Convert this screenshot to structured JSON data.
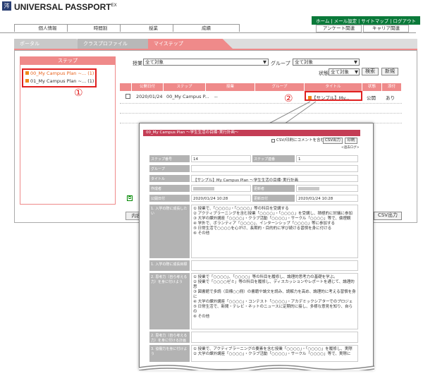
{
  "app": {
    "logo_glyph": "涔",
    "title": "UNIVERSAL PASSPORT",
    "title_suffix": "EX"
  },
  "top_links": [
    "ホーム",
    "メール設定",
    "サイトマップ",
    "ログアウト"
  ],
  "sub_links": [
    "アンケート関連",
    "キャリア関連"
  ],
  "main_tabs": [
    "個人情報",
    "時間割",
    "授業",
    "成績"
  ],
  "tabs2": {
    "portal": "ポータル",
    "class_profile": "クラスプロファイル",
    "mystep": "マイステップ"
  },
  "step_panel": {
    "header": "ステップ",
    "items": [
      {
        "label": "00_My Campus Plan ~...",
        "count": "(1)"
      },
      {
        "label": "01_My Campus Plan ~...",
        "count": "(1)"
      }
    ]
  },
  "annotations": {
    "one": "①",
    "two": "②"
  },
  "filters": {
    "jugyo_label": "授業",
    "jugyo_value": "全て対象",
    "group_label": "グループ",
    "group_value": "全て対象",
    "state_label": "状態",
    "state_value": "全て対象",
    "search_btn": "検索",
    "new_btn": "新規"
  },
  "table": {
    "headers": [
      "公開日付",
      "ステップ",
      "授業",
      "グループ",
      "タイトル",
      "状態",
      "添付"
    ],
    "rows": [
      {
        "date": "2020/01/24",
        "step": "00_My Campus P...",
        "class": "--",
        "group": "",
        "title": "【サンプル】My...",
        "state": "公開",
        "attach": "あり"
      }
    ]
  },
  "bottom": {
    "naiyou": "内容",
    "csv_out": "CSV出力"
  },
  "popup": {
    "title": "00_My Campus Plan ～学生生活の目標･実行計画～",
    "csv_comment": "CSV/印刷にコメントを含む",
    "csv_btn": "CSV出力",
    "print_btn": "印刷",
    "history_link": "<過去ログ>",
    "fields": [
      {
        "label": "ステップ番号",
        "value": "14",
        "label2": "ステップ連番",
        "value2": "1"
      },
      {
        "label": "グループ",
        "value": ""
      },
      {
        "label": "タイトル",
        "value": "【サンプル】My Campus Plan ～学生生活の目標･実行計画"
      },
      {
        "label": "作成者",
        "value": "",
        "label2": "更新者",
        "value2": ""
      },
      {
        "label": "公開日付",
        "value": "2020/01/24 10:28",
        "label2": "更新日付",
        "value2": "2020/01/24 10:28"
      }
    ],
    "sections": [
      {
        "label": "1. 入学の際に成長したい",
        "lines": [
          "① 授業で、「○○○○」・「○○○○」等の科目を受講する",
          "② アクティブラーニングを含む授業「○○○○」・「○○○○」を受講し、積極的に討議に参加",
          "③ 大学の課外講座「○○○○」・クラブ活動「○○○○」・サークル「○○○○」等で、倫理観",
          "④ 学外で、ボランティア「○○○○」、インターンシップ「○○○○」等に参加する",
          "⑤ 日常生活で○○○○を心がけ、長期的・目的的に学び続ける習慣を身に付ける",
          "⑥ その他"
        ]
      },
      {
        "label": "1. 入学の際に成長目標",
        "lines": [
          ""
        ]
      },
      {
        "label": "2. 思考力（自ら考える力）を身に付けよう",
        "lines": [
          "① 授業で「○○○○」、「○○○○」等の科目を履修し、論理的思考力の基礎を学ぶ。",
          "② 授業で「○○○○ゼミ」等の科目を履修し、ディスカッションやレポートを通じて、論理的思",
          "③ 図書館で多読（目標○○冊）の書籍や論文を読み、読解力を高め、論理的に考える習慣を身に",
          "④ 大学の課外講座「○○○○」・コンテスト「○○○○」・アカデミックシアターでのプロジェ",
          "⑤ 日常生活で、新聞・テレビ・ネットのニュースに定期的に接し、多様な意見を知り、自らの",
          "⑥ その他"
        ]
      },
      {
        "label": "2. 思考力（自ら考える力）を身に付ける計画",
        "lines": [
          ""
        ]
      },
      {
        "label": "3. 協働力を身に付けよう",
        "lines": [
          "① 授業で、アクティブラーニングの要素を含む授業「○○○○」・「○○○○」を履修し、実際",
          "② 大学の課外講座「○○○○」・クラブ活動「○○○○」・サークル「○○○○」等で、実際に"
        ]
      }
    ]
  }
}
